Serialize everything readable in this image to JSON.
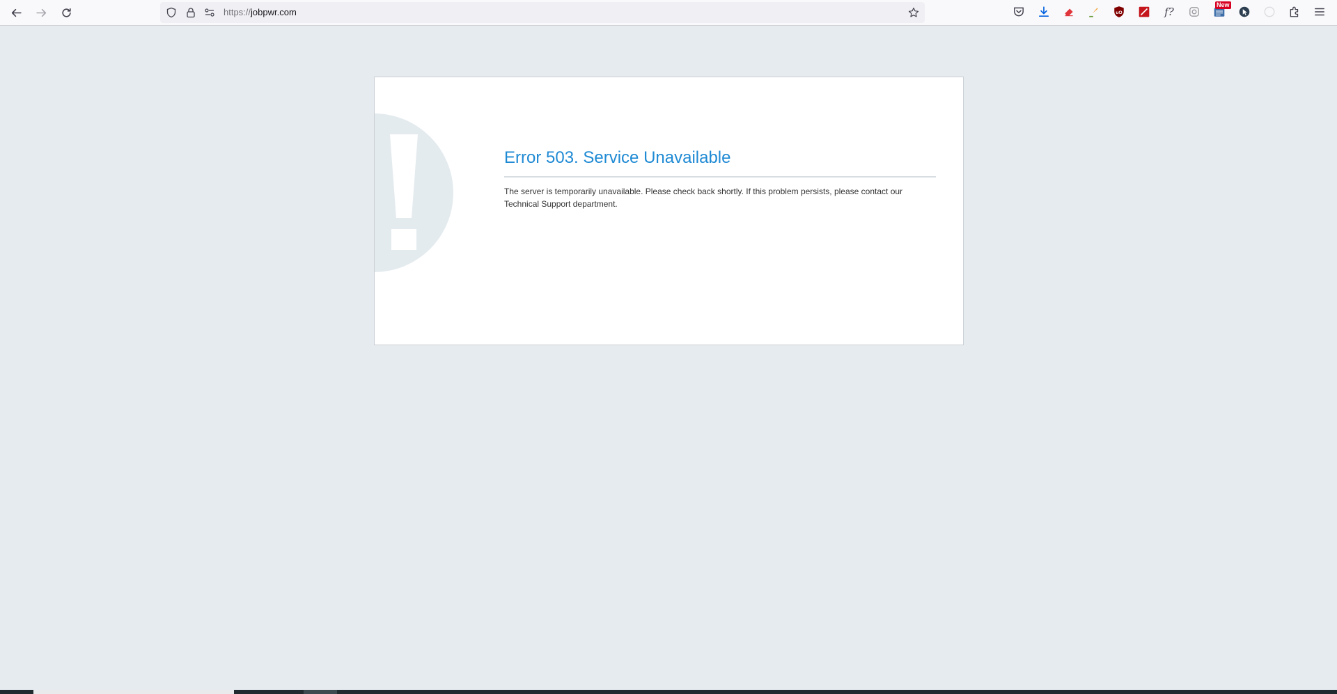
{
  "browser": {
    "url_scheme": "https://",
    "url_host": "jobpwr.com",
    "extensions": [
      {
        "name": "pocket-icon",
        "color": "#42414d"
      },
      {
        "name": "download-icon",
        "color": "#0060df"
      },
      {
        "name": "eraser-extension-icon",
        "color": "#e0353b"
      },
      {
        "name": "brush-extension-icon",
        "color": "#f0a030"
      },
      {
        "name": "ublock-icon",
        "color": "#800000"
      },
      {
        "name": "pdf-extension-icon",
        "color": "#c4161c"
      },
      {
        "name": "font-finder-icon",
        "color": "#42414d"
      },
      {
        "name": "instagram-icon",
        "color": "#9a9aa0"
      },
      {
        "name": "newsletter-extension-icon",
        "color": "#3d6ea8"
      },
      {
        "name": "cursor-extension-icon",
        "color": "#2c3e50"
      },
      {
        "name": "disabled-extension-icon",
        "color": "#dcdce0"
      },
      {
        "name": "extensions-puzzle-icon",
        "color": "#42414d"
      },
      {
        "name": "menu-icon",
        "color": "#42414d"
      }
    ],
    "new_badge": "New"
  },
  "page": {
    "title": "Error 503. Service Unavailable",
    "message": "The server is temporarily unavailable. Please check back shortly. If this problem persists, please contact our Technical Support department.",
    "accent_color": "#1f8ad4",
    "background_color": "#e6ebef"
  }
}
